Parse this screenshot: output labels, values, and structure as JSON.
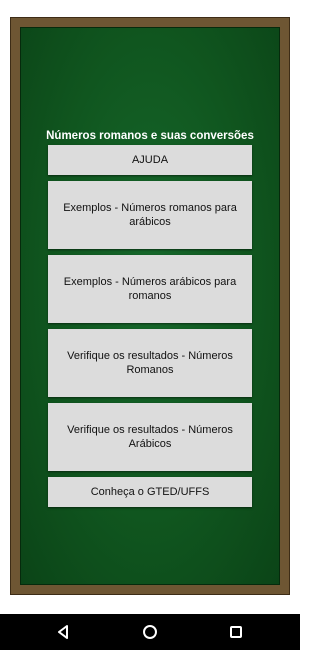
{
  "app": {
    "title": "Números romanos e suas conversões",
    "buttons": [
      {
        "id": "ajuda",
        "label": "AJUDA"
      },
      {
        "id": "exemplos-romanos-arabicos",
        "label": "Exemplos - Números romanos para arábicos"
      },
      {
        "id": "exemplos-arabicos-romanos",
        "label": "Exemplos - Números arábicos para romanos"
      },
      {
        "id": "verifique-romanos",
        "label": "Verifique os resultados - Números Romanos"
      },
      {
        "id": "verifique-arabicos",
        "label": "Verifique os resultados - Números Arábicos"
      },
      {
        "id": "conheca-gted",
        "label": "Conheça o GTED/UFFS"
      }
    ]
  },
  "colors": {
    "board_green": "#10561f",
    "frame_brown": "#6e5633",
    "button_gray": "#dcdcdc"
  },
  "navbar": {
    "icons": [
      "back-icon",
      "home-icon",
      "recents-icon"
    ]
  }
}
